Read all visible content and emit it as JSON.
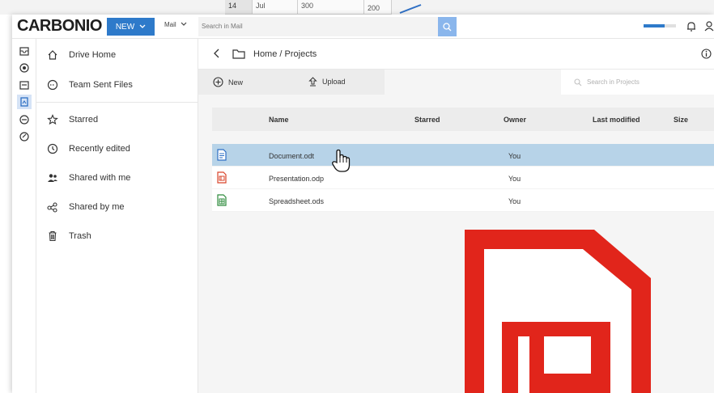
{
  "background_sheet": {
    "cells": [
      "14",
      "Jul",
      "300",
      "200"
    ]
  },
  "topbar": {
    "logo": "CARBONIO",
    "new_label": "NEW",
    "module_label": "Mail",
    "search_placeholder": "Search in Mail",
    "quota_fraction": 0.65
  },
  "rail": {
    "items": [
      "mail-icon",
      "contacts-icon",
      "calendar-icon",
      "files-icon",
      "chats-icon",
      "tasks-icon"
    ],
    "active_index": 3
  },
  "sidebar": {
    "items": [
      {
        "label": "Drive Home",
        "icon": "home-icon"
      },
      {
        "label": "Team Sent Files",
        "icon": "team-files-icon"
      },
      {
        "label": "Starred",
        "icon": "star-icon"
      },
      {
        "label": "Recently edited",
        "icon": "clock-icon"
      },
      {
        "label": "Shared with me",
        "icon": "people-icon"
      },
      {
        "label": "Shared by me",
        "icon": "share-icon"
      },
      {
        "label": "Trash",
        "icon": "trash-icon"
      }
    ]
  },
  "breadcrumb": {
    "path": "Home / Projects"
  },
  "actions": {
    "new_label": "New",
    "upload_label": "Upload",
    "search_placeholder": "Search in Projects"
  },
  "table": {
    "headers": {
      "name": "Name",
      "starred": "Starred",
      "owner": "Owner",
      "last_modified": "Last modified",
      "size": "Size"
    },
    "rows": [
      {
        "name": "Document.odt",
        "owner": "You",
        "type": "document",
        "color": "#2e6fc4",
        "selected": true
      },
      {
        "name": "Presentation.odp",
        "owner": "You",
        "type": "presentation",
        "color": "#d9452b",
        "selected": false
      },
      {
        "name": "Spreadsheet.ods",
        "owner": "You",
        "type": "spreadsheet",
        "color": "#2e8b3c",
        "selected": false
      }
    ]
  },
  "colors": {
    "accent": "#2e7aca",
    "selected_row": "#b7d3e8",
    "presentation_icon": "#e1251b"
  }
}
